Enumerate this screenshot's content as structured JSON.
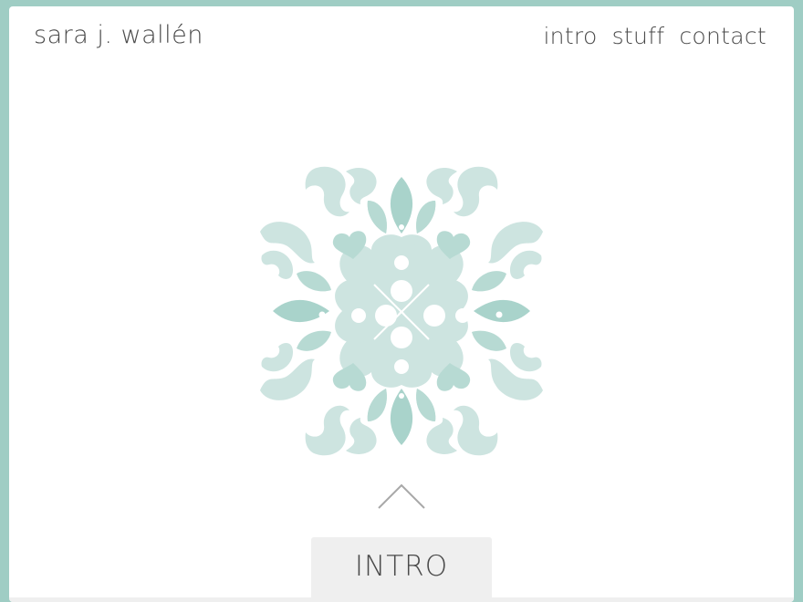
{
  "header": {
    "site_title": "sara j. wallén",
    "nav": [
      {
        "label": "intro"
      },
      {
        "label": "stuff"
      },
      {
        "label": "contact"
      }
    ]
  },
  "hero": {
    "ornament_icon": "floral-ornament-icon",
    "scroll_icon": "chevron-up-icon"
  },
  "section_tab": {
    "label": "INTRO"
  },
  "colors": {
    "frame_bg": "#9fcdc4",
    "ornament_light": "#cde4e0",
    "ornament_dark": "#a9d3cb",
    "text": "#4a4a4a",
    "tab_bg": "#efefef"
  }
}
